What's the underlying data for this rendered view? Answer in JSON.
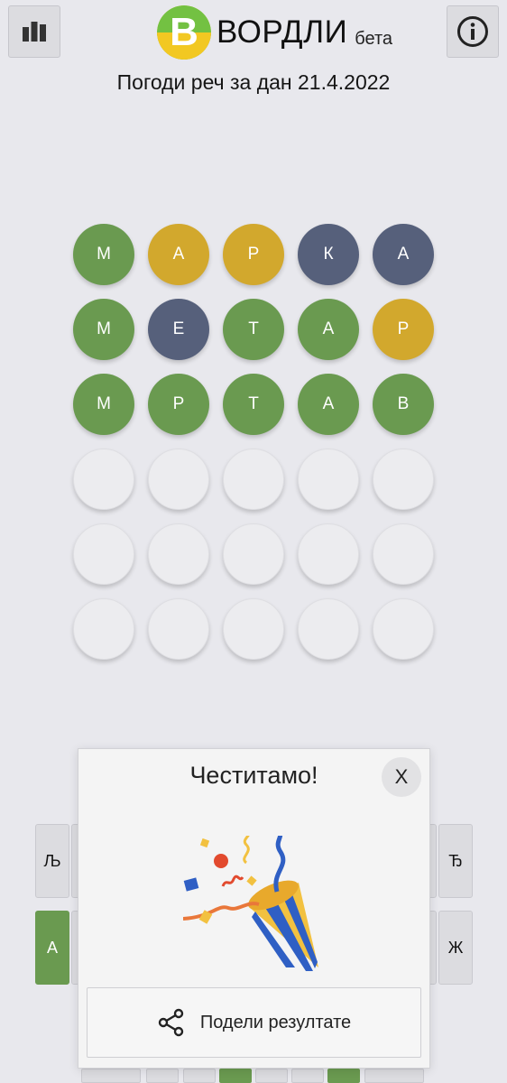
{
  "header": {
    "logo_letter": "В",
    "title": "ВОРДЛИ",
    "beta_label": "бета",
    "stats_icon": "bar-chart-icon",
    "info_icon": "info-icon",
    "subtitle": "Погоди реч за дан 21.4.2022"
  },
  "colors": {
    "correct": "#6a9a50",
    "present": "#d2a82d",
    "absent": "#56607b",
    "background": "#e8e8ed"
  },
  "board": {
    "rows": [
      [
        {
          "letter": "М",
          "state": "correct"
        },
        {
          "letter": "А",
          "state": "present"
        },
        {
          "letter": "Р",
          "state": "present"
        },
        {
          "letter": "К",
          "state": "absent"
        },
        {
          "letter": "А",
          "state": "absent"
        }
      ],
      [
        {
          "letter": "М",
          "state": "correct"
        },
        {
          "letter": "Е",
          "state": "absent"
        },
        {
          "letter": "Т",
          "state": "correct"
        },
        {
          "letter": "А",
          "state": "correct"
        },
        {
          "letter": "Р",
          "state": "present"
        }
      ],
      [
        {
          "letter": "М",
          "state": "correct"
        },
        {
          "letter": "Р",
          "state": "correct"
        },
        {
          "letter": "Т",
          "state": "correct"
        },
        {
          "letter": "А",
          "state": "correct"
        },
        {
          "letter": "В",
          "state": "correct"
        }
      ],
      [
        {
          "letter": "",
          "state": "empty"
        },
        {
          "letter": "",
          "state": "empty"
        },
        {
          "letter": "",
          "state": "empty"
        },
        {
          "letter": "",
          "state": "empty"
        },
        {
          "letter": "",
          "state": "empty"
        }
      ],
      [
        {
          "letter": "",
          "state": "empty"
        },
        {
          "letter": "",
          "state": "empty"
        },
        {
          "letter": "",
          "state": "empty"
        },
        {
          "letter": "",
          "state": "empty"
        },
        {
          "letter": "",
          "state": "empty"
        }
      ],
      [
        {
          "letter": "",
          "state": "empty"
        },
        {
          "letter": "",
          "state": "empty"
        },
        {
          "letter": "",
          "state": "empty"
        },
        {
          "letter": "",
          "state": "empty"
        },
        {
          "letter": "",
          "state": "empty"
        }
      ]
    ]
  },
  "keyboard": {
    "visible_keys": {
      "lj": {
        "label": "Љ",
        "state": "default"
      },
      "dj": {
        "label": "Ђ",
        "state": "default"
      },
      "a": {
        "label": "А",
        "state": "correct"
      },
      "zh": {
        "label": "Ж",
        "state": "default"
      }
    }
  },
  "modal": {
    "title": "Честитамо!",
    "close_label": "X",
    "share_label": "Подели резултате",
    "share_icon": "share-icon",
    "illustration": "party-popper-icon"
  }
}
